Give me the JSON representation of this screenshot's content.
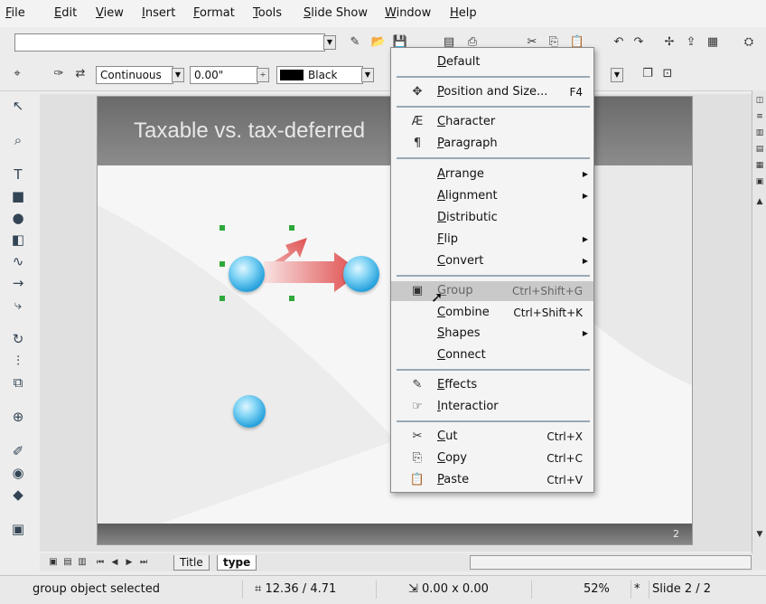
{
  "menubar": {
    "items": [
      "File",
      "Edit",
      "View",
      "Insert",
      "Format",
      "Tools",
      "Slide Show",
      "Window",
      "Help"
    ]
  },
  "toolbar2": {
    "line_style": "Continuous",
    "line_width": "0.00\"",
    "line_color": "Black"
  },
  "slide": {
    "title": "Taxable vs. tax-deferred",
    "page_number": "2"
  },
  "context_menu": {
    "items": [
      {
        "label": "Default",
        "shortcut": "",
        "submenu": false,
        "icon": ""
      },
      {
        "label": "Position and Size...",
        "shortcut": "F4",
        "submenu": false,
        "icon": "position-size-icon"
      },
      {
        "label": "Character",
        "shortcut": "",
        "submenu": false,
        "icon": "character-icon"
      },
      {
        "label": "Paragraph",
        "shortcut": "",
        "submenu": false,
        "icon": "paragraph-icon"
      },
      {
        "label": "Arrange",
        "shortcut": "",
        "submenu": true,
        "icon": ""
      },
      {
        "label": "Alignment",
        "shortcut": "",
        "submenu": true,
        "icon": ""
      },
      {
        "label": "Distributic",
        "shortcut": "",
        "submenu": false,
        "icon": ""
      },
      {
        "label": "Flip",
        "shortcut": "",
        "submenu": true,
        "icon": ""
      },
      {
        "label": "Convert",
        "shortcut": "",
        "submenu": true,
        "icon": ""
      },
      {
        "label": "Group",
        "shortcut": "Ctrl+Shift+G",
        "submenu": false,
        "icon": "group-icon"
      },
      {
        "label": "Combine",
        "shortcut": "Ctrl+Shift+K",
        "submenu": false,
        "icon": ""
      },
      {
        "label": "Shapes",
        "shortcut": "",
        "submenu": true,
        "icon": ""
      },
      {
        "label": "Connect",
        "shortcut": "",
        "submenu": false,
        "icon": ""
      },
      {
        "label": "Effects",
        "shortcut": "",
        "submenu": false,
        "icon": "effects-icon"
      },
      {
        "label": "Interactior",
        "shortcut": "",
        "submenu": false,
        "icon": "interaction-icon"
      },
      {
        "label": "Cut",
        "shortcut": "Ctrl+X",
        "submenu": false,
        "icon": "cut-icon"
      },
      {
        "label": "Copy",
        "shortcut": "Ctrl+C",
        "submenu": false,
        "icon": "copy-icon"
      },
      {
        "label": "Paste",
        "shortcut": "Ctrl+V",
        "submenu": false,
        "icon": "paste-icon"
      }
    ]
  },
  "tabs": [
    "Title",
    "type"
  ],
  "status": {
    "message": "group object selected",
    "position": "12.36 / 4.71",
    "size": "0.00 x 0.00",
    "zoom": "52%",
    "modified": "*",
    "slide": "Slide 2 / 2"
  },
  "colors": {
    "selection_handle": "#2ea83b",
    "ball": "#2aa3dd",
    "arrow": "#e05050"
  }
}
